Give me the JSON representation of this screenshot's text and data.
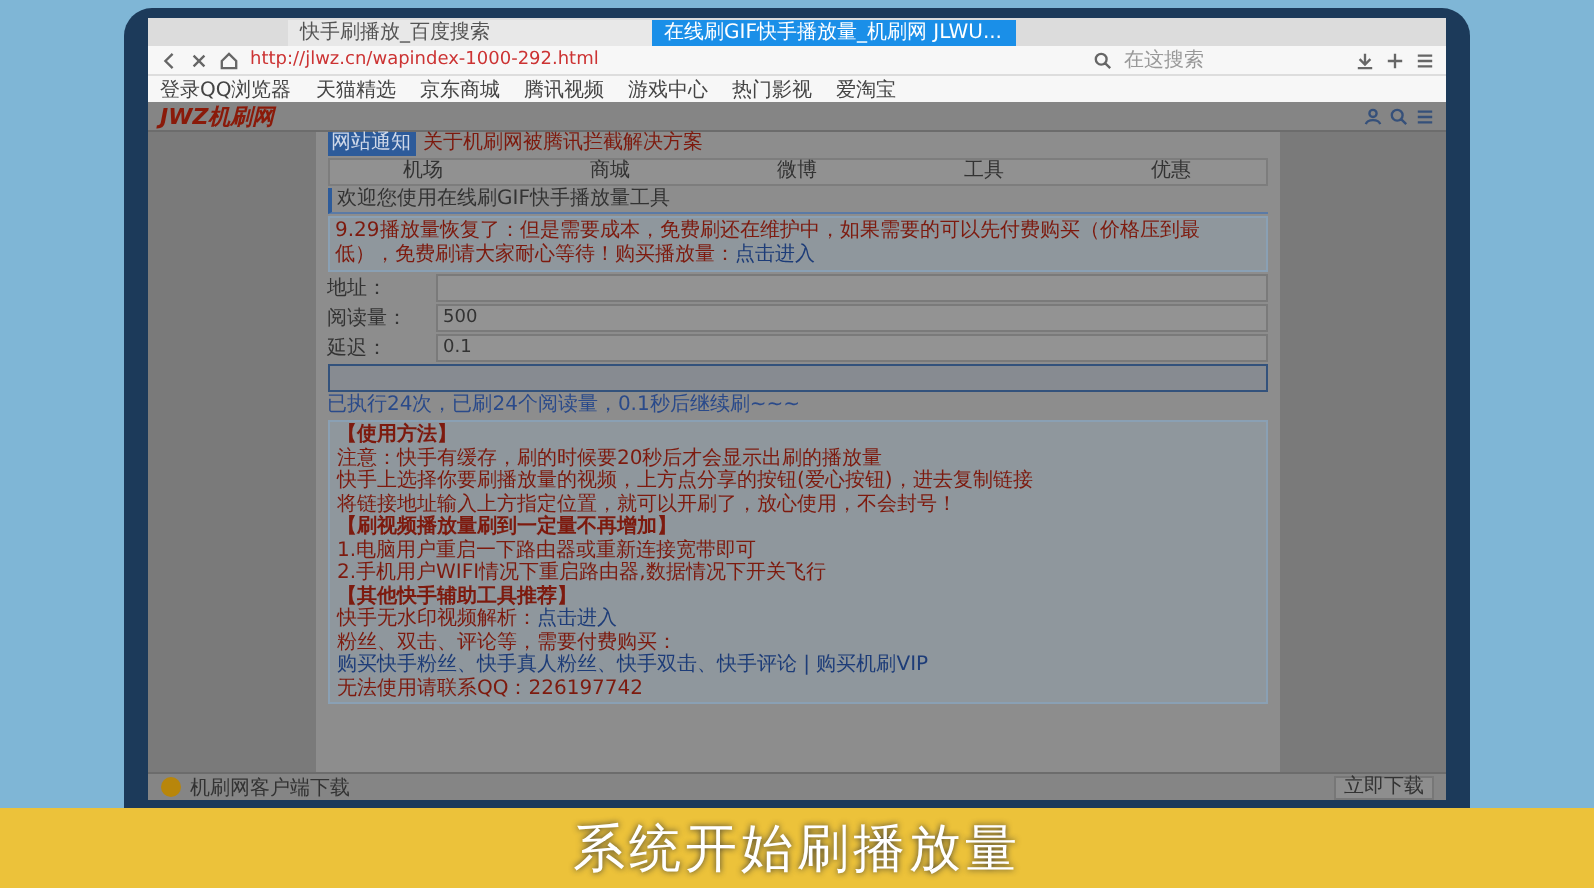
{
  "browser": {
    "tabs": [
      {
        "label": "快手刷播放_百度搜索",
        "selected": false
      },
      {
        "label": "在线刷GIF快手播放量_机刷网 JLWU...",
        "selected": true
      }
    ],
    "address": "http://jlwz.cn/wapindex-1000-292.html",
    "search": {
      "placeholder": "在这搜索"
    },
    "bookmarks": [
      "登录QQ浏览器",
      "天猫精选",
      "京东商城",
      "腾讯视频",
      "游戏中心",
      "热门影视",
      "爱淘宝"
    ]
  },
  "site": {
    "logo": "JWZ机刷网",
    "notice": {
      "badge": "网站通知",
      "title": "关于机刷网被腾讯拦截解决方案"
    },
    "nav": [
      "机场",
      "商城",
      "微博",
      "工具",
      "优惠"
    ],
    "heading": "欢迎您使用在线刷GIF快手播放量工具",
    "announcement": {
      "text": "9.29播放量恢复了：但是需要成本，免费刷还在维护中，如果需要的可以先付费购买（价格压到最低），免费刷请大家耐心等待！购买播放量：",
      "link": "点击进入"
    },
    "fields": [
      {
        "label": "地址："
      },
      {
        "label": "阅读量：",
        "value": "500"
      },
      {
        "label": "延迟：",
        "value": "0.1"
      }
    ],
    "result": "已执行24次，已刷24个阅读量，0.1秒后继续刷~~~",
    "usage": [
      {
        "kind": "title",
        "text": "【使用方法】"
      },
      {
        "kind": "text",
        "text": "注意：快手有缓存，刷的时候要20秒后才会显示出刷的播放量"
      },
      {
        "kind": "text",
        "text": "快手上选择你要刷播放量的视频，上方点分享的按钮(爱心按钮)，进去复制链接"
      },
      {
        "kind": "text",
        "text": "将链接地址输入上方指定位置，就可以开刷了，放心使用，不会封号！"
      },
      {
        "kind": "title",
        "text": "【刷视频播放量刷到一定量不再增加】"
      },
      {
        "kind": "text",
        "text": "1.电脑用户重启一下路由器或重新连接宽带即可"
      },
      {
        "kind": "text",
        "text": "2.手机用户WIFI情况下重启路由器,数据情况下开关飞行"
      },
      {
        "kind": "title",
        "text": "【其他快手辅助工具推荐】"
      },
      {
        "kind": "text",
        "text": "快手无水印视频解析：",
        "link": "点击进入"
      },
      {
        "kind": "text",
        "text": "粉丝、双击、评论等，需要付费购买："
      },
      {
        "kind": "link",
        "text": "购买快手粉丝、快手真人粉丝、快手双击、快手评论 | 购买机刷VIP"
      },
      {
        "kind": "text",
        "text": "无法使用请联系QQ：226197742"
      }
    ],
    "download": {
      "text": "机刷网客户端下载",
      "button": "立即下载"
    }
  },
  "caption": "系统开始刷播放量"
}
